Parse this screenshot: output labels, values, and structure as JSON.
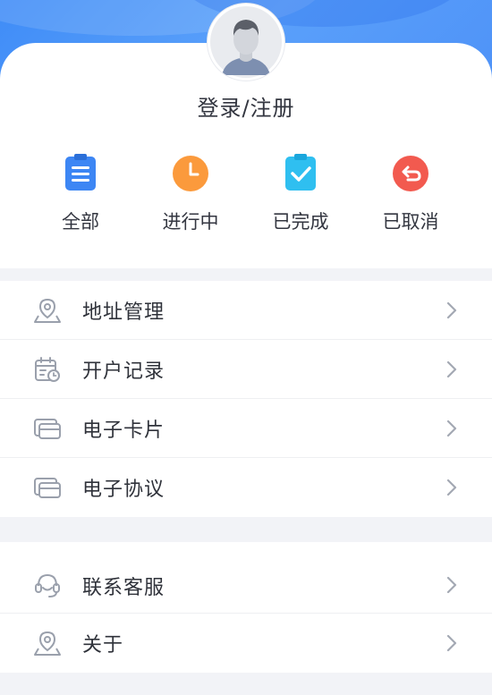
{
  "header": {
    "login_label": "登录/注册"
  },
  "orders": [
    {
      "label": "全部",
      "icon": "clipboard-list-icon",
      "color": "#3d86f4"
    },
    {
      "label": "进行中",
      "icon": "clock-icon",
      "color": "#fb9a3c"
    },
    {
      "label": "已完成",
      "icon": "clipboard-check-icon",
      "color": "#2fbff0"
    },
    {
      "label": "已取消",
      "icon": "undo-icon",
      "color": "#f25a4f"
    }
  ],
  "menu_group_1": [
    {
      "label": "地址管理",
      "icon": "location-pin-icon"
    },
    {
      "label": "开户记录",
      "icon": "calendar-clock-icon"
    },
    {
      "label": "电子卡片",
      "icon": "card-icon"
    },
    {
      "label": "电子协议",
      "icon": "card-icon"
    }
  ],
  "menu_group_2": [
    {
      "label": "联系客服",
      "icon": "headset-icon"
    },
    {
      "label": "关于",
      "icon": "location-pin-icon"
    }
  ]
}
